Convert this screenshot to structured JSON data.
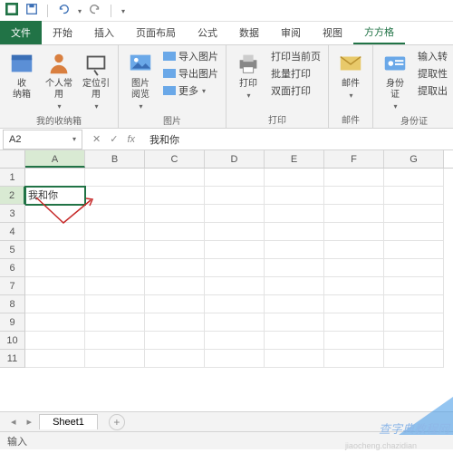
{
  "qat": {
    "save": "保存",
    "undo": "撤销",
    "redo": "重做"
  },
  "tabs": {
    "file": "文件",
    "home": "开始",
    "insert": "插入",
    "layout": "页面布局",
    "formula": "公式",
    "data": "数据",
    "review": "审阅",
    "view": "视图",
    "square": "方方格"
  },
  "ribbon": {
    "g1": {
      "label": "我的收纳箱",
      "b1": "收\n纳箱",
      "b2": "个人常\n用",
      "b3": "定位引\n用"
    },
    "g2": {
      "label": "图片",
      "b1": "图片\n阅览",
      "s1": "导入图片",
      "s2": "导出图片",
      "s3": "更多"
    },
    "g3": {
      "label": "打印",
      "b1": "打印",
      "s1": "打印当前页",
      "s2": "批量打印",
      "s3": "双面打印"
    },
    "g4": {
      "label": "邮件",
      "b1": "邮件"
    },
    "g5": {
      "label": "身份证",
      "b1": "身份\n证",
      "s1": "输入转",
      "s2": "提取性",
      "s3": "提取出"
    }
  },
  "namebox": {
    "ref": "A2",
    "fx": "fx",
    "cancel": "✕",
    "confirm": "✓",
    "value": "我和你"
  },
  "cols": [
    "A",
    "B",
    "C",
    "D",
    "E",
    "F",
    "G"
  ],
  "rows": [
    "1",
    "2",
    "3",
    "4",
    "5",
    "6",
    "7",
    "8",
    "9",
    "10",
    "11"
  ],
  "cell_a2": "我和你",
  "sheet": {
    "name": "Sheet1",
    "add": "+"
  },
  "status": "输入",
  "watermark": "查字典教程网",
  "wm2": "jiaocheng.chazidian"
}
